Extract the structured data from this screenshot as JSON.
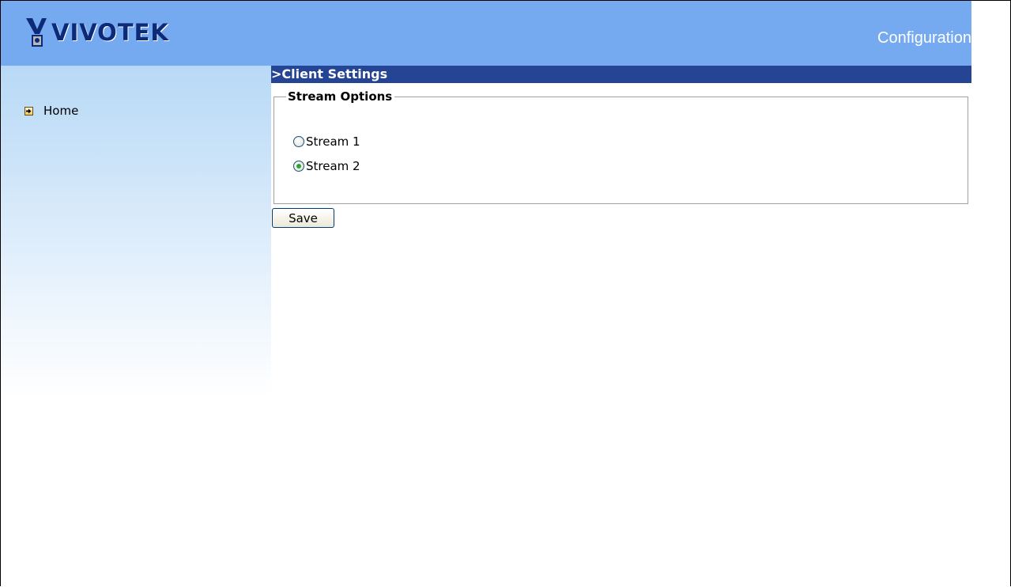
{
  "header": {
    "logo_text": "VIVOTEK",
    "title": "Configuration"
  },
  "sidebar": {
    "items": [
      {
        "label": "Home",
        "icon": "arrow-right-box-icon"
      }
    ]
  },
  "main": {
    "section_title": ">Client Settings",
    "stream_options": {
      "legend": "Stream Options",
      "options": [
        {
          "label": "Stream 1",
          "checked": false
        },
        {
          "label": "Stream 2",
          "checked": true
        }
      ]
    },
    "save_label": "Save"
  },
  "colors": {
    "header_bg": "#75a9f0",
    "section_bar_bg": "#254494",
    "logo_text": "#0d2a78",
    "radio_checked": "#2fa52f"
  }
}
